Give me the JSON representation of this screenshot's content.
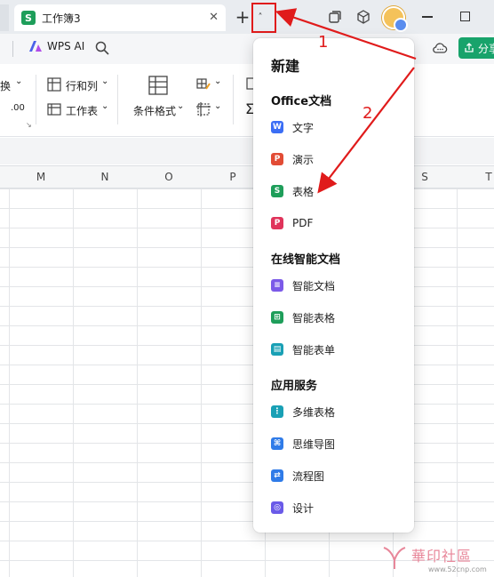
{
  "titlebar": {
    "tab_badge": "S",
    "tab_title": "工作簿3",
    "tab_close": "✕",
    "new_tab": "+",
    "new_tab_dropdown": "˄",
    "icons": [
      "window-icon",
      "cube-icon",
      "avatar",
      "minimize-icon",
      "maximize-icon"
    ]
  },
  "menubar": {
    "wps_ai_label": "WPS AI",
    "share_label": "分享"
  },
  "ribbon": {
    "convert_label": "换",
    "rows_cols_label": "行和列",
    "worksheet_label": "工作表",
    "conditional_format_label": "条件格式",
    "decimal_label": ".00"
  },
  "sheet": {
    "columns": [
      "M",
      "N",
      "O",
      "P",
      "S",
      "T"
    ]
  },
  "new_menu": {
    "title": "新建",
    "sections": [
      {
        "title": "Office文档",
        "items": [
          {
            "label": "文字",
            "badge": "W",
            "color": "#3b6ef5"
          },
          {
            "label": "演示",
            "badge": "P",
            "color": "#e24c35"
          },
          {
            "label": "表格",
            "badge": "S",
            "color": "#1e9e5a"
          },
          {
            "label": "PDF",
            "badge": "P",
            "color": "#e0345b"
          }
        ]
      },
      {
        "title": "在线智能文档",
        "items": [
          {
            "label": "智能文档",
            "badge": "≡",
            "color": "#7b5ae8"
          },
          {
            "label": "智能表格",
            "badge": "⊞",
            "color": "#1e9e5a"
          },
          {
            "label": "智能表单",
            "badge": "▤",
            "color": "#19a0b5"
          }
        ]
      },
      {
        "title": "应用服务",
        "items": [
          {
            "label": "多维表格",
            "badge": "⋮",
            "color": "#19a0b5"
          },
          {
            "label": "思维导图",
            "badge": "⌘",
            "color": "#2f7be8"
          },
          {
            "label": "流程图",
            "badge": "⇄",
            "color": "#2f7be8"
          },
          {
            "label": "设计",
            "badge": "◎",
            "color": "#6a5ae8"
          }
        ]
      }
    ]
  },
  "annotations": {
    "step1": "1",
    "step2": "2",
    "color": "#e01b1b"
  },
  "watermark": {
    "text": "華印社區",
    "url": "www.52cnp.com"
  }
}
